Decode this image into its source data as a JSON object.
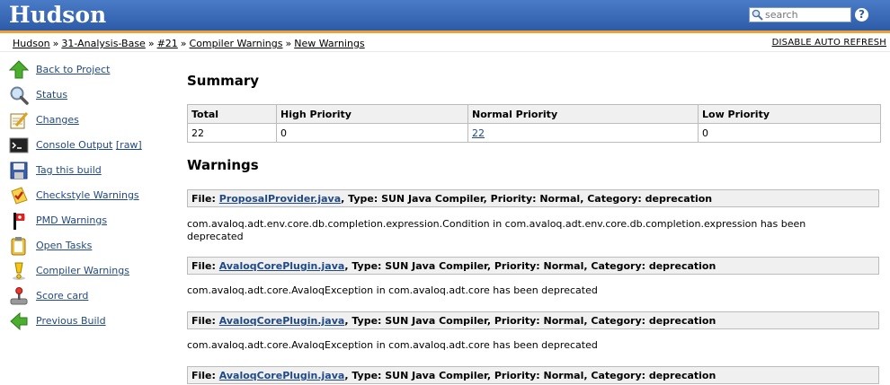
{
  "header": {
    "title": "Hudson",
    "search_placeholder": "search",
    "help_symbol": "?"
  },
  "breadcrumbs": [
    "Hudson",
    "31-Analysis-Base",
    "#21",
    "Compiler Warnings",
    "New Warnings"
  ],
  "breadcrumb_sep": "»",
  "disable_refresh": "DISABLE AUTO REFRESH",
  "sidebar": {
    "items": [
      {
        "label": "Back to Project",
        "icon": "up-arrow-icon"
      },
      {
        "label": "Status",
        "icon": "magnifier-icon"
      },
      {
        "label": "Changes",
        "icon": "notepad-icon"
      },
      {
        "label": "Console Output",
        "extra": "[raw]",
        "icon": "terminal-icon"
      },
      {
        "label": "Tag this build",
        "icon": "floppy-icon"
      },
      {
        "label": "Checkstyle Warnings",
        "icon": "checkstyle-icon"
      },
      {
        "label": "PMD Warnings",
        "icon": "pmd-icon"
      },
      {
        "label": "Open Tasks",
        "icon": "clipboard-icon"
      },
      {
        "label": "Compiler Warnings",
        "icon": "warning-icon"
      },
      {
        "label": "Score card",
        "icon": "joystick-icon"
      },
      {
        "label": "Previous Build",
        "icon": "left-arrow-icon"
      }
    ]
  },
  "summary": {
    "title": "Summary",
    "headers": [
      "Total",
      "High Priority",
      "Normal Priority",
      "Low Priority"
    ],
    "values": [
      "22",
      "0",
      "22",
      "0"
    ]
  },
  "warnings": {
    "title": "Warnings",
    "items": [
      {
        "file_prefix": "File:",
        "file": "ProposalProvider.java",
        "rest": ", Type: SUN Java Compiler, Priority: Normal, Category: deprecation",
        "message": "com.avaloq.adt.env.core.db.completion.expression.Condition in com.avaloq.adt.env.core.db.completion.expression has been deprecated"
      },
      {
        "file_prefix": "File:",
        "file": "AvaloqCorePlugin.java",
        "rest": ", Type: SUN Java Compiler, Priority: Normal, Category: deprecation",
        "message": "com.avaloq.adt.core.AvaloqException in com.avaloq.adt.core has been deprecated"
      },
      {
        "file_prefix": "File:",
        "file": "AvaloqCorePlugin.java",
        "rest": ", Type: SUN Java Compiler, Priority: Normal, Category: deprecation",
        "message": "com.avaloq.adt.core.AvaloqException in com.avaloq.adt.core has been deprecated"
      },
      {
        "file_prefix": "File:",
        "file": "AvaloqCorePlugin.java",
        "rest": ", Type: SUN Java Compiler, Priority: Normal, Category: deprecation",
        "message": ""
      }
    ]
  },
  "colors": {
    "header_top": "#4a7bc6",
    "header_bottom": "#2d5ba8",
    "stripe": "#f0a030",
    "link": "#204a87"
  }
}
